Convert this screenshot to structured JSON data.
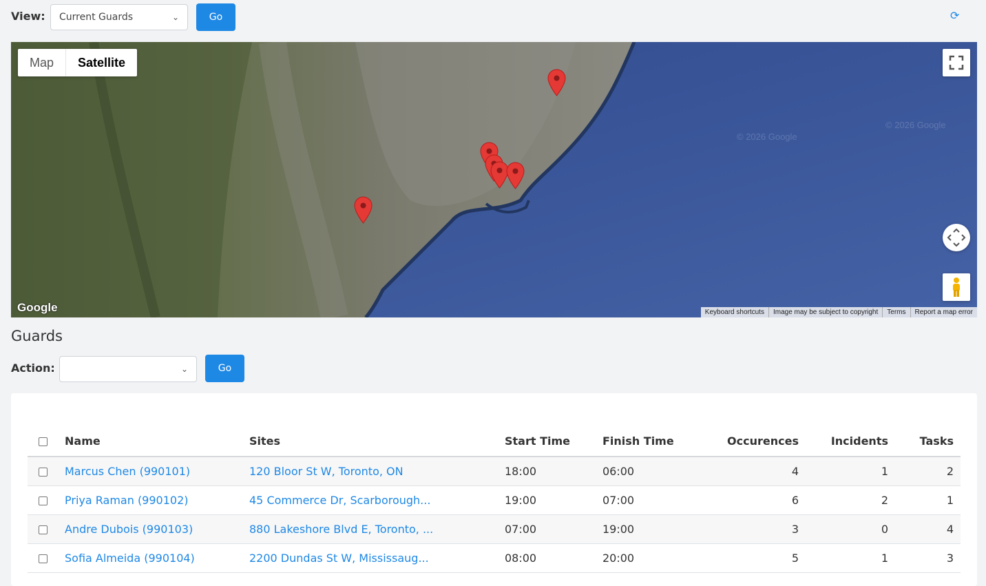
{
  "toolbar": {
    "view_label": "View:",
    "view_value": "Current Guards",
    "go_label": "Go",
    "refresh_icon": "refresh-icon"
  },
  "map": {
    "type_options": [
      "Map",
      "Satellite"
    ],
    "selected_type": "Satellite",
    "logo_text": "Google",
    "watermark": "© 2026 Google",
    "attribution": [
      "Keyboard shortcuts",
      "Image may be subject to copyright",
      "Terms",
      "Report a map error"
    ],
    "controls": [
      "fullscreen-icon",
      "camera-move-icon",
      "pegman-icon"
    ],
    "marker_color": "#e53935",
    "marker_count": 7
  },
  "guards": {
    "title": "Guards",
    "action_label": "Action:",
    "action_value": "",
    "go_label": "Go",
    "columns": [
      "Name",
      "Sites",
      "Start Time",
      "Finish Time",
      "Occurences",
      "Incidents",
      "Tasks"
    ],
    "rows": [
      {
        "name": "Marcus Chen (990101)",
        "site": "120 Bloor St W, Toronto, ON",
        "start": "18:00",
        "finish": "06:00",
        "occurences": "4",
        "incidents": "1",
        "tasks": "2"
      },
      {
        "name": "Priya Raman (990102)",
        "site": "45 Commerce Dr, Scarborough...",
        "start": "19:00",
        "finish": "07:00",
        "occurences": "6",
        "incidents": "2",
        "tasks": "1"
      },
      {
        "name": "Andre Dubois (990103)",
        "site": "880 Lakeshore Blvd E, Toronto, ...",
        "start": "07:00",
        "finish": "19:00",
        "occurences": "3",
        "incidents": "0",
        "tasks": "4"
      },
      {
        "name": "Sofia Almeida (990104)",
        "site": "2200 Dundas St W, Mississaug...",
        "start": "08:00",
        "finish": "20:00",
        "occurences": "5",
        "incidents": "1",
        "tasks": "3"
      }
    ]
  },
  "colors": {
    "accent": "#1e88e5",
    "background": "#f2f3f5",
    "lake": "#3c5a9a",
    "land": "#5f6b4a"
  }
}
